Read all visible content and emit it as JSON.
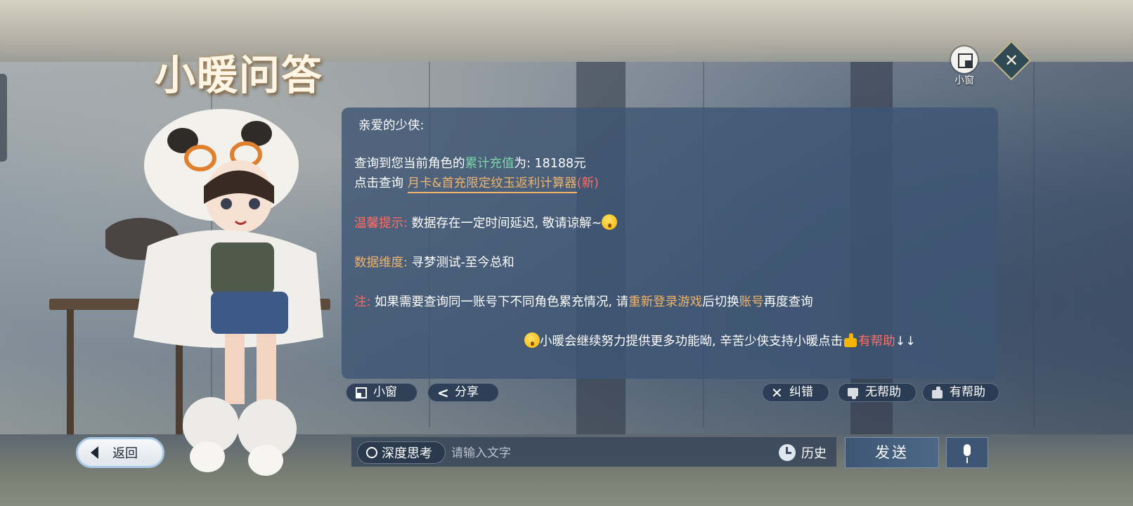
{
  "header": {
    "title": "小暖问答",
    "mini_window_label": "小窗",
    "close_icon": "close-icon"
  },
  "answer": {
    "greeting": "亲爱的少侠:",
    "recharge_prefix": "查询到您当前角色的",
    "recharge_key": "累计充值",
    "recharge_suffix": "为: 18188元",
    "link_prefix": "点击查询",
    "link_text": "月卡&首充限定纹玉返利计算器",
    "link_new": "(新)",
    "tip_label": "温馨提示:",
    "tip_text": "数据存在一定时间延迟, 敬请谅解~",
    "dimension_label": "数据维度:",
    "dimension_text": "寻梦测试-至今总和",
    "note_label": "注:",
    "note_text_1": "如果需要查询同一账号下不同角色累充情况, 请",
    "note_highlight_1": "重新登录游戏",
    "note_text_2": "后切换",
    "note_highlight_2": "账号",
    "note_text_3": "再度查询",
    "closing_text": "小暖会继续努力提供更多功能呦, 辛苦少侠支持小暖点击",
    "closing_highlight": "有帮助",
    "closing_arrows": "↓↓"
  },
  "actions": {
    "mini_window": "小窗",
    "share": "分享",
    "correct": "纠错",
    "not_helpful": "无帮助",
    "helpful": "有帮助"
  },
  "bottom": {
    "back": "返回",
    "deep_think": "深度思考",
    "input_placeholder": "请输入文字",
    "input_value": "",
    "history": "历史",
    "send": "发送"
  },
  "colors": {
    "card_bg": "#3e5674",
    "green": "#7cd6a7",
    "orange": "#f0b36a",
    "red": "#ff6d63"
  }
}
